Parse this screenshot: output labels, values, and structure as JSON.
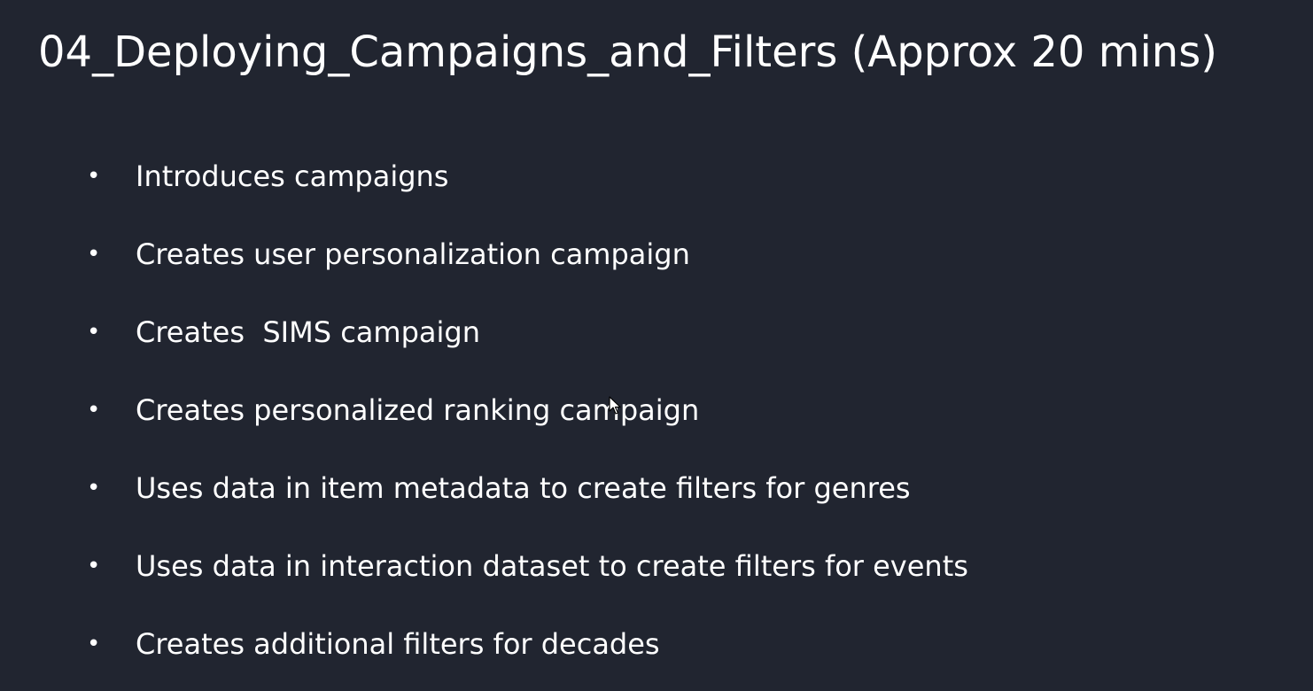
{
  "slide": {
    "title": "04_Deploying_Campaigns_and_Filters (Approx 20 mins)",
    "bullet_symbol": "•",
    "bullets": [
      "Introduces campaigns",
      "Creates user personalization campaign",
      "Creates  SIMS campaign",
      "Creates personalized ranking campaign",
      "Uses data in item metadata to create filters for genres",
      "Uses data in interaction dataset to create filters for events",
      "Creates additional filters for decades"
    ]
  },
  "colors": {
    "background": "#212530",
    "text": "#ffffff"
  },
  "icons": {
    "pointer": "mouse-pointer-cursor-icon"
  }
}
